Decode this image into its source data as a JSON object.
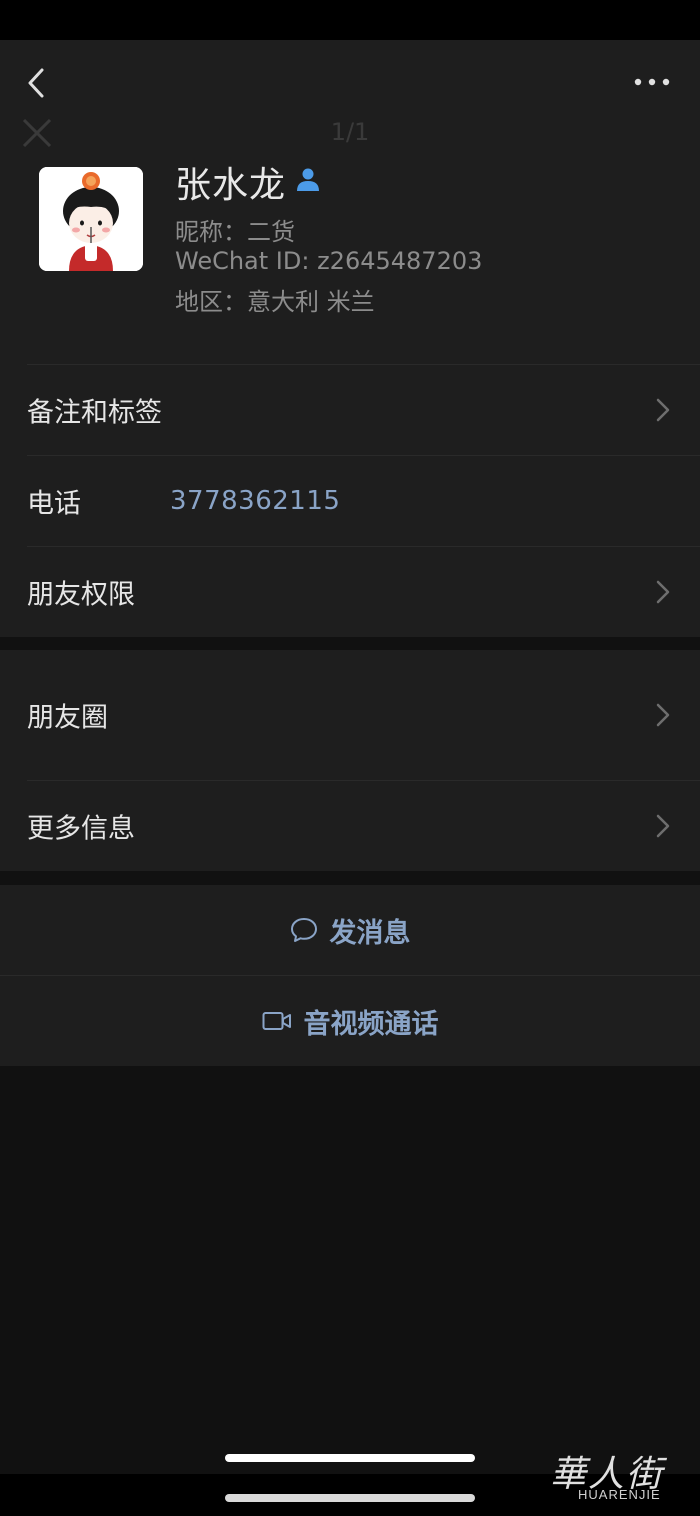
{
  "ghost": {
    "counter": "1/1"
  },
  "profile": {
    "name": "张水龙",
    "nickname": "昵称：二货",
    "wechat_id": "WeChat ID: z2645487203",
    "region": "地区：意大利 米兰"
  },
  "rows": {
    "remarks_tags": "备注和标签",
    "phone_label": "电话",
    "phone_value": "3778362115",
    "friend_permissions": "朋友权限",
    "moments": "朋友圈",
    "more_info": "更多信息"
  },
  "actions": {
    "send_message": "发消息",
    "video_call": "音视频通话"
  },
  "watermark": {
    "cn": "華人街",
    "en": "HUARENJIE"
  },
  "colors": {
    "accent": "#8aa4c7",
    "badge": "#4c9be8",
    "surface": "#1e1e1e",
    "background": "#111111"
  },
  "icons": [
    "back-arrow-icon",
    "more-dots-icon",
    "close-icon",
    "contact-badge-icon",
    "chevron-right-icon",
    "chat-bubble-icon",
    "video-camera-icon"
  ]
}
